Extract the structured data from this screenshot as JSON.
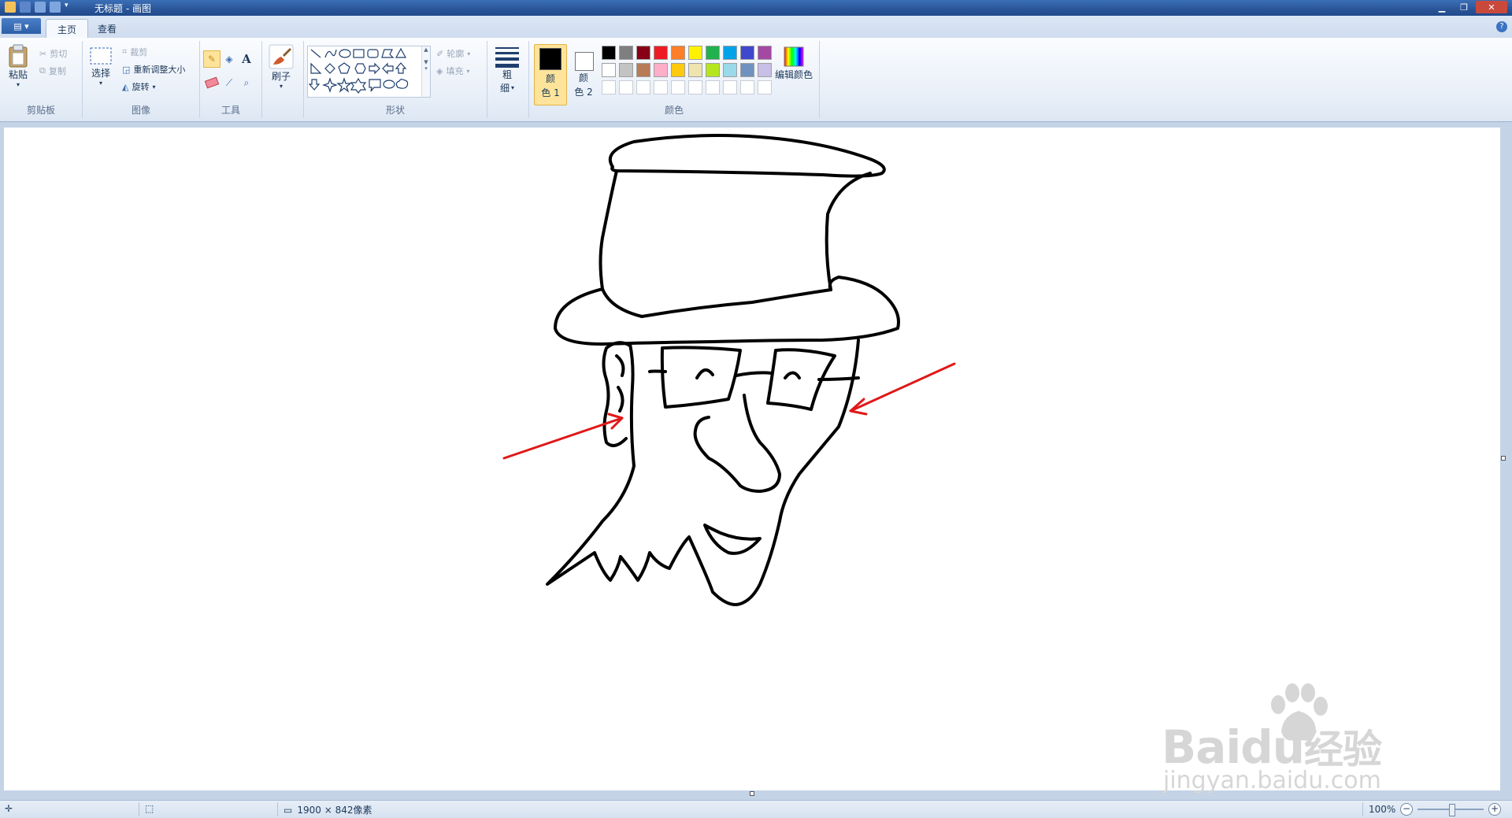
{
  "window": {
    "title": "无标题 - 画图",
    "qat_icons": [
      "paint-app-icon",
      "save-icon",
      "undo-icon",
      "redo-icon",
      "customize-qat-icon"
    ]
  },
  "tabs": {
    "file_label": "",
    "home": "主页",
    "view": "查看"
  },
  "ribbon": {
    "clipboard": {
      "paste": "粘贴",
      "cut": "剪切",
      "copy": "复制",
      "group": "剪贴板"
    },
    "image": {
      "select": "选择",
      "crop": "裁剪",
      "resize": "重新调整大小",
      "rotate": "旋转",
      "group": "图像"
    },
    "tools": {
      "group": "工具",
      "text_glyph": "A"
    },
    "brushes": {
      "label": "刷子"
    },
    "shapes": {
      "outline": "轮廓",
      "fill": "填充",
      "group": "形状"
    },
    "size": {
      "line1": "粗",
      "line2": "细"
    },
    "colors": {
      "color1_l1": "颜",
      "color1_l2": "色 1",
      "color2_l1": "颜",
      "color2_l2": "色 2",
      "edit": "编辑颜色",
      "group": "颜色",
      "color1_value": "#000000",
      "color2_value": "#ffffff",
      "palette_row1": [
        "#000000",
        "#7f7f7f",
        "#880015",
        "#ed1c24",
        "#ff7f27",
        "#fff200",
        "#22b14c",
        "#00a2e8",
        "#3f48cc",
        "#a349a4"
      ],
      "palette_row2": [
        "#ffffff",
        "#c3c3c3",
        "#b97a57",
        "#ffaec9",
        "#ffc90e",
        "#efe4b0",
        "#b5e61d",
        "#99d9ea",
        "#7092be",
        "#c8bfe7"
      ]
    }
  },
  "status": {
    "canvas_size": "1900 × 842像素",
    "zoom": "100%"
  },
  "watermark": {
    "brand": "Bai",
    "brand2": "du",
    "cn": "经验",
    "url": "jingyan.baidu.com"
  }
}
